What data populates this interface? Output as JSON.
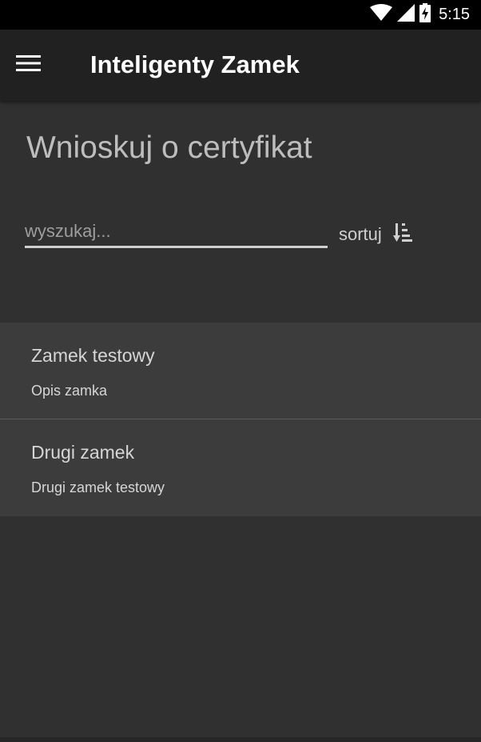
{
  "status_bar": {
    "time": "5:15",
    "icons": [
      "wifi-icon",
      "cell-signal-icon",
      "battery-charging-icon"
    ]
  },
  "app_bar": {
    "title": "Inteligenty Zamek",
    "menu_icon": "hamburger-menu-icon"
  },
  "main": {
    "title": "Wnioskuj o certyfikat",
    "search": {
      "placeholder": "wyszukaj...",
      "value": ""
    },
    "sort": {
      "label": "sortuj",
      "icon": "sort-descending-icon"
    }
  },
  "locks": [
    {
      "name": "Zamek testowy",
      "description": "Opis zamka"
    },
    {
      "name": "Drugi zamek",
      "description": "Drugi zamek testowy"
    }
  ],
  "colors": {
    "background": "#303030",
    "app_bar": "#212121",
    "list_background": "#3c3c3c",
    "status_bar": "#000000"
  }
}
